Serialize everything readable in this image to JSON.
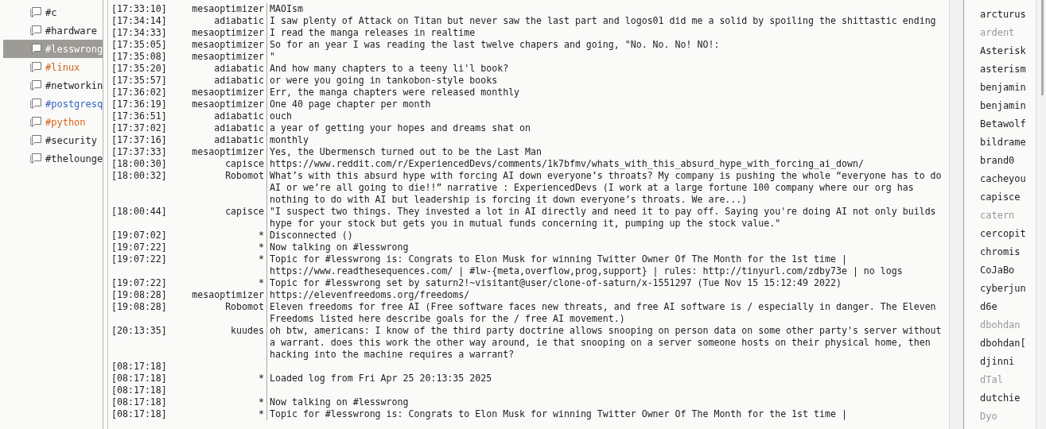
{
  "channels": [
    {
      "name": "#c",
      "selected": false,
      "color": "#222222"
    },
    {
      "name": "#hardware",
      "selected": false,
      "color": "#222222"
    },
    {
      "name": "#lesswrong",
      "selected": true,
      "color": "#ffffff"
    },
    {
      "name": "#linux",
      "selected": false,
      "color": "#d2601a"
    },
    {
      "name": "#networkin",
      "selected": false,
      "color": "#222222"
    },
    {
      "name": "#postgresq",
      "selected": false,
      "color": "#3a66c4"
    },
    {
      "name": "#python",
      "selected": false,
      "color": "#e0641c"
    },
    {
      "name": "#security",
      "selected": false,
      "color": "#222222"
    },
    {
      "name": "#thelounge",
      "selected": false,
      "color": "#222222"
    }
  ],
  "messages": [
    {
      "time": "[17:33:10]",
      "nick": "mesaoptimizer",
      "text": "MAOIsm"
    },
    {
      "time": "[17:34:14]",
      "nick": "adiabatic",
      "text": "I saw plenty of Attack on Titan but never saw the last part and logos01 did me a solid by spoiling the shittastic ending"
    },
    {
      "time": "[17:34:33]",
      "nick": "mesaoptimizer",
      "text": "I read the manga releases in realtime"
    },
    {
      "time": "[17:35:05]",
      "nick": "mesaoptimizer",
      "text": "So for an year I was reading the last twelve chapers and going, \"No. No. No! NO!:"
    },
    {
      "time": "[17:35:08]",
      "nick": "mesaoptimizer",
      "text": "\""
    },
    {
      "time": "[17:35:20]",
      "nick": "adiabatic",
      "text": "And how many chapters to a teeny li'l book?"
    },
    {
      "time": "[17:35:57]",
      "nick": "adiabatic",
      "text": "or were you going in tankobon-style books"
    },
    {
      "time": "[17:36:02]",
      "nick": "mesaoptimizer",
      "text": "Err, the manga chapters were released monthly"
    },
    {
      "time": "[17:36:19]",
      "nick": "mesaoptimizer",
      "text": "One 40 page chapter per month"
    },
    {
      "time": "[17:36:51]",
      "nick": "adiabatic",
      "text": "ouch"
    },
    {
      "time": "[17:37:02]",
      "nick": "adiabatic",
      "text": "a year of getting your hopes and dreams shat on"
    },
    {
      "time": "[17:37:16]",
      "nick": "adiabatic",
      "text": "monthly"
    },
    {
      "time": "[17:37:33]",
      "nick": "mesaoptimizer",
      "text": "Yes, the Ubermensch turned out to be the Last Man"
    },
    {
      "time": "[18:00:30]",
      "nick": "capisce",
      "text": "https://www.reddit.com/r/ExperiencedDevs/comments/1k7bfmv/whats_with_this_absurd_hype_with_forcing_ai_down/"
    },
    {
      "time": "[18:00:32]",
      "nick": "Robomot",
      "text": "What’s with this absurd hype with forcing AI down everyone’s throats? My company is pushing the whole “everyone has to do AI or we’re all going to die!!” narrative : ExperiencedDevs (I work at a large fortune 100 company where our org has nothing to do with AI but leadership is forcing it down everyone’s throats. We are...)"
    },
    {
      "time": "[18:00:44]",
      "nick": "capisce",
      "text": "\"I suspect two things. They invested a lot in AI directly and need it to pay off. Saying you're doing AI not only builds hype for your stock but gets you in mutual funds concerning it, pumping up the stock value.\""
    },
    {
      "time": "[19:07:02]",
      "nick": "*",
      "text": "Disconnected ()"
    },
    {
      "time": "[19:07:22]",
      "nick": "*",
      "text": "Now talking on #lesswrong"
    },
    {
      "time": "[19:07:22]",
      "nick": "*",
      "text": "Topic for #lesswrong is: Congrats to Elon Musk for winning Twitter Owner Of The Month for the 1st time | https://www.readthesequences.com/ | #lw-{meta,overflow,prog,support} | rules: http://tinyurl.com/zdby73e | no logs"
    },
    {
      "time": "[19:07:22]",
      "nick": "*",
      "text": "Topic for #lesswrong set by saturn2!~visitant@user/clone-of-saturn/x-1551297 (Tue Nov 15 15:12:49 2022)"
    },
    {
      "time": "[19:08:28]",
      "nick": "mesaoptimizer",
      "text": "https://elevenfreedoms.org/freedoms/"
    },
    {
      "time": "[19:08:28]",
      "nick": "Robomot",
      "text": "Eleven freedoms for free AI (Free software faces new threats, and free AI software is / especially in danger. The Eleven Freedoms listed here describe goals for the / free AI movement.)"
    },
    {
      "time": "[20:13:35]",
      "nick": "kuudes",
      "text": "oh btw, americans: I know of the third party doctrine allows snooping on person data on some other party's server without a warrant. does this work the other way around, ie that snooping on a server someone hosts on their physical home, then hacking into the machine requires a warrant?"
    },
    {
      "time": "[08:17:18]"
    },
    {
      "time": "[08:17:18]",
      "nick": "*",
      "text": "Loaded log from Fri Apr 25 20:13:35 2025"
    },
    {
      "time": "[08:17:18]"
    },
    {
      "time": "[08:17:18]",
      "nick": "*",
      "text": "Now talking on #lesswrong"
    },
    {
      "time": "[08:17:18]",
      "nick": "*",
      "text": "Topic for #lesswrong is: Congrats to Elon Musk for winning Twitter Owner Of The Month for the 1st time |"
    }
  ],
  "users": [
    {
      "name": "arcturus",
      "away": false
    },
    {
      "name": "ardent",
      "away": true
    },
    {
      "name": "Asterisk",
      "away": false
    },
    {
      "name": "asterism",
      "away": false
    },
    {
      "name": "benjamin",
      "away": false
    },
    {
      "name": "benjamin",
      "away": false
    },
    {
      "name": "Betawolf",
      "away": false
    },
    {
      "name": "bildrame",
      "away": false
    },
    {
      "name": "brand0",
      "away": false
    },
    {
      "name": "cacheyou",
      "away": false
    },
    {
      "name": "capisce",
      "away": false
    },
    {
      "name": "catern",
      "away": true
    },
    {
      "name": "cercopit",
      "away": false
    },
    {
      "name": "chromis",
      "away": false
    },
    {
      "name": "CoJaBo",
      "away": false
    },
    {
      "name": "cyberjun",
      "away": false
    },
    {
      "name": "d6e",
      "away": false
    },
    {
      "name": "dbohdan",
      "away": true
    },
    {
      "name": "dbohdan[",
      "away": false
    },
    {
      "name": "djinni",
      "away": false
    },
    {
      "name": "dTal",
      "away": true
    },
    {
      "name": "dutchie",
      "away": false
    },
    {
      "name": "Dyo",
      "away": true
    }
  ]
}
